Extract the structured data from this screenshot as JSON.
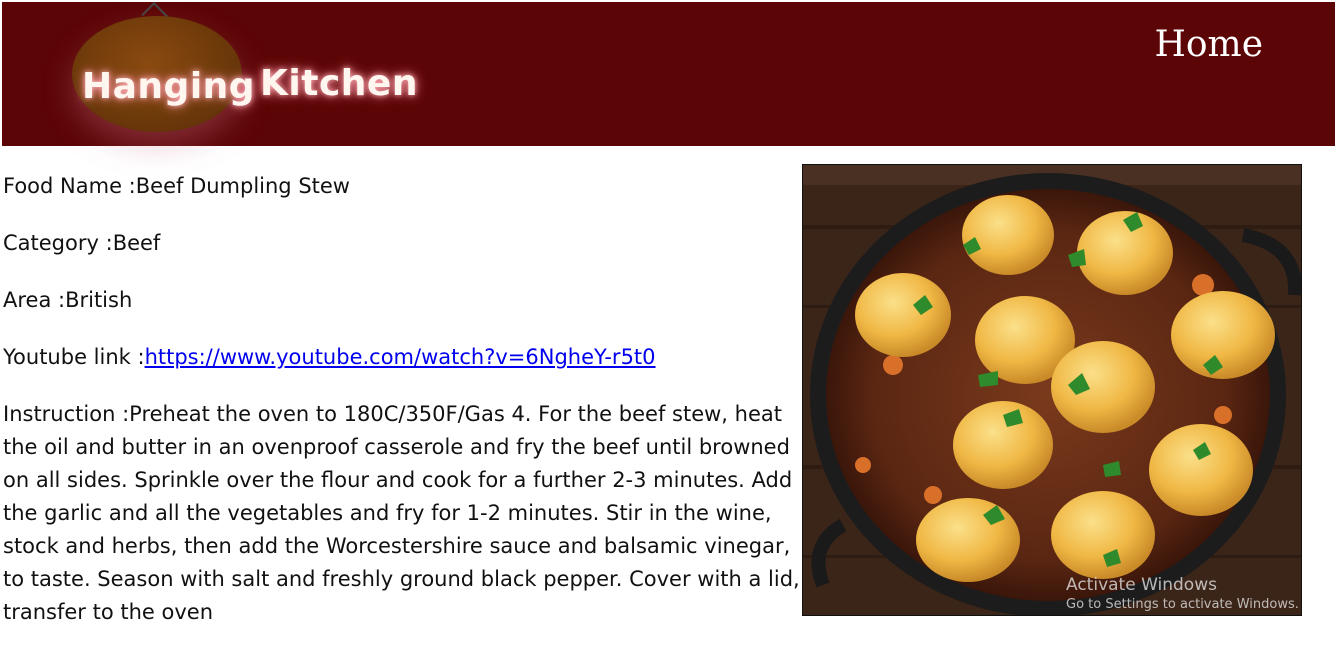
{
  "header": {
    "logo_word_1": "Hanging",
    "logo_word_2": "Kitchen",
    "home_label": "Home"
  },
  "recipe": {
    "food_name_label": "Food Name :",
    "food_name": "Beef Dumpling Stew",
    "category_label": "Category :",
    "category": "Beef",
    "area_label": "Area :",
    "area": "British",
    "youtube_label": "Youtube link :",
    "youtube_url": "https://www.youtube.com/watch?v=6NgheY-r5t0",
    "instruction_label": "Instruction :",
    "instruction": "Preheat the oven to 180C/350F/Gas 4. For the beef stew, heat the oil and butter in an ovenproof casserole and fry the beef until browned on all sides. Sprinkle over the flour and cook for a further 2-3 minutes. Add the garlic and all the vegetables and fry for 1-2 minutes. Stir in the wine, stock and herbs, then add the Worcestershire sauce and balsamic vinegar, to taste. Season with salt and freshly ground black pepper. Cover with a lid, transfer to the oven"
  },
  "watermark": {
    "title": "Activate Windows",
    "subtitle": "Go to Settings to activate Windows."
  },
  "icons": {
    "photo": "stew-dish-photo"
  }
}
